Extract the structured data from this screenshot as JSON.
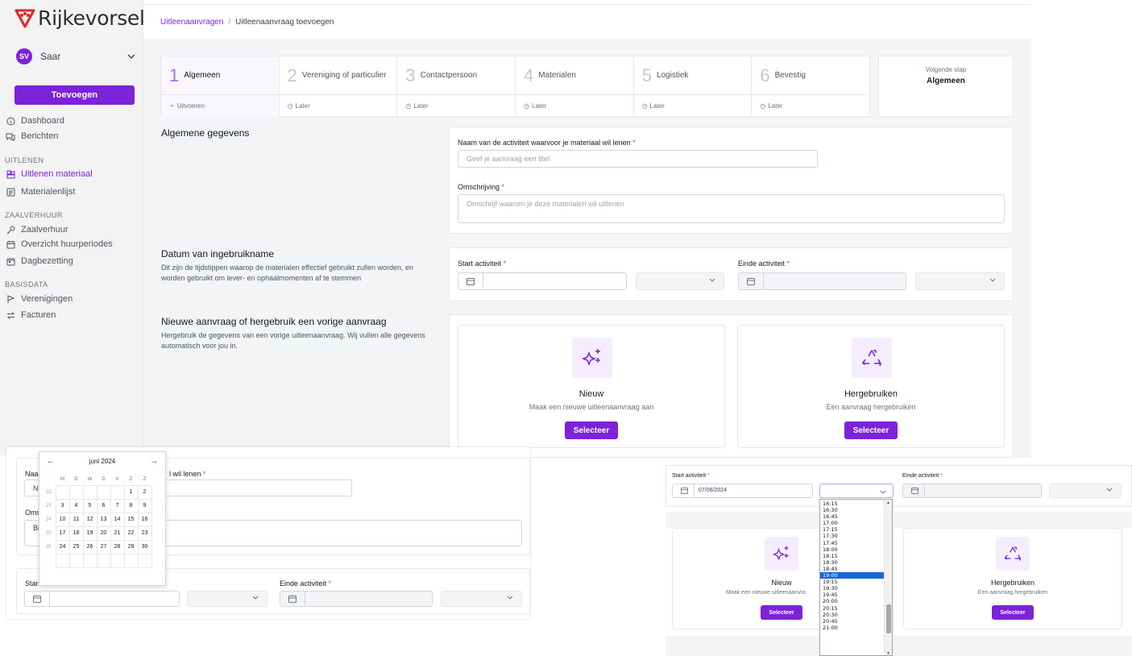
{
  "brand": {
    "name": "Rijkevorsel",
    "accent": "#7c22d9",
    "logo_color": "#e2262c"
  },
  "user": {
    "initials": "SV",
    "name": "Saar"
  },
  "sidebar": {
    "add_label": "Toevoegen",
    "items_top": [
      {
        "label": "Dashboard",
        "icon": "info-icon"
      },
      {
        "label": "Berichten",
        "icon": "chat-icon"
      }
    ],
    "section_uitlenen": "UITLENEN",
    "items_uitlenen": [
      {
        "label": "Uitlenen materiaal",
        "icon": "boxes-icon",
        "active": true
      },
      {
        "label": "Materialenlijst",
        "icon": "list-icon"
      }
    ],
    "section_zaal": "ZAALVERHUUR",
    "items_zaal": [
      {
        "label": "Zaalverhuur",
        "icon": "key-icon"
      },
      {
        "label": "Overzicht huurperiodes",
        "icon": "calendar-icon"
      },
      {
        "label": "Dagbezetting",
        "icon": "calendar-day-icon"
      }
    ],
    "section_basis": "BASISDATA",
    "items_basis": [
      {
        "label": "Verenigingen",
        "icon": "flag-icon"
      },
      {
        "label": "Facturen",
        "icon": "swap-icon"
      }
    ]
  },
  "breadcrumb": {
    "parent": "Uitleenaanvragen",
    "separator": "/",
    "current": "Uitleenaanvraag toevoegen"
  },
  "steps": [
    {
      "num": "1",
      "label": "Algemeen",
      "status": "Uitvoeren",
      "active": true
    },
    {
      "num": "2",
      "label": "Vereniging of particulier",
      "status": "Later"
    },
    {
      "num": "3",
      "label": "Contactpersoon",
      "status": "Later"
    },
    {
      "num": "4",
      "label": "Materialen",
      "status": "Later"
    },
    {
      "num": "5",
      "label": "Logistiek",
      "status": "Later"
    },
    {
      "num": "6",
      "label": "Bevestig",
      "status": "Later"
    }
  ],
  "next_step": {
    "label": "Volgende stap",
    "value": "Algemeen"
  },
  "general": {
    "title": "Algemene gegevens",
    "name_label": "Naam van de activiteit waarvoor je materiaal wil lenen",
    "name_placeholder": "Geef je aanvraag een titel",
    "desc_label": "Omschrijving",
    "desc_placeholder": "Omschrijf waarom je deze materialen wil uitlenen",
    "required": "*"
  },
  "usage": {
    "title": "Datum van ingebruikname",
    "description": "Dit zijn de tijdstippen waarop de materialen effectief gebruikt zullen worden, en worden gebruikt om lever- en ophaalmomenten af te stemmen",
    "start_label": "Start activiteit",
    "end_label": "Einde activiteit"
  },
  "reuse": {
    "title": "Nieuwe aanvraag of hergebruik een vorige aanvraag",
    "description": "Hergebruik de gegevens van een vorige uitleenaanvraag. Wij vullen alle gegevens automatisch voor jou in.",
    "new_title": "Nieuw",
    "new_sub": "Maak een nieuwe uitleenaanvraag aan",
    "reuse_title": "Hergebruiken",
    "reuse_sub": "Een aanvraag hergebruiken",
    "select_label": "Selecteer"
  },
  "overlay_left": {
    "name_label_cut": "Naa",
    "name_label_tail": "l wil lenen",
    "name_value_cut": "Na",
    "desc_label_cut": "Oms",
    "desc_value_cut": "Bu",
    "start_label_cut": "Star",
    "end_label": "Einde activiteit"
  },
  "calendar": {
    "month": "juni 2024",
    "prev": "←",
    "next": "→",
    "weekdays": [
      "M",
      "D",
      "W",
      "D",
      "V",
      "Z",
      "Z"
    ],
    "weeks": [
      {
        "wk": "22",
        "days": [
          "",
          "",
          "",
          "",
          "",
          "1",
          "2"
        ]
      },
      {
        "wk": "23",
        "days": [
          "3",
          "4",
          "5",
          "6",
          "7",
          "8",
          "9"
        ]
      },
      {
        "wk": "24",
        "days": [
          "10",
          "11",
          "12",
          "13",
          "14",
          "15",
          "16"
        ]
      },
      {
        "wk": "25",
        "days": [
          "17",
          "18",
          "19",
          "20",
          "21",
          "22",
          "23"
        ]
      },
      {
        "wk": "26",
        "days": [
          "24",
          "25",
          "26",
          "27",
          "28",
          "29",
          "30"
        ]
      },
      {
        "wk": "",
        "days": [
          "",
          "",
          "",
          "",
          "",
          "",
          ""
        ]
      }
    ]
  },
  "overlay_right": {
    "start_label": "Start activiteit",
    "end_label": "Einde activiteit",
    "start_date": "07/06/2024",
    "new_title": "Nieuw",
    "new_sub_cut": "Maak een nieuwe uitleenaanvra",
    "reuse_title": "Hergebruiken",
    "reuse_sub": "Een aanvraag hergebruiken",
    "select_label": "Selecteer"
  },
  "times": {
    "selected": "19:00",
    "options": [
      "16:15",
      "16:30",
      "16:45",
      "17:00",
      "17:15",
      "17:30",
      "17:45",
      "18:00",
      "18:15",
      "18:30",
      "18:45",
      "19:00",
      "19:15",
      "19:30",
      "19:45",
      "20:00",
      "20:15",
      "20:30",
      "20:45",
      "21:00"
    ]
  }
}
